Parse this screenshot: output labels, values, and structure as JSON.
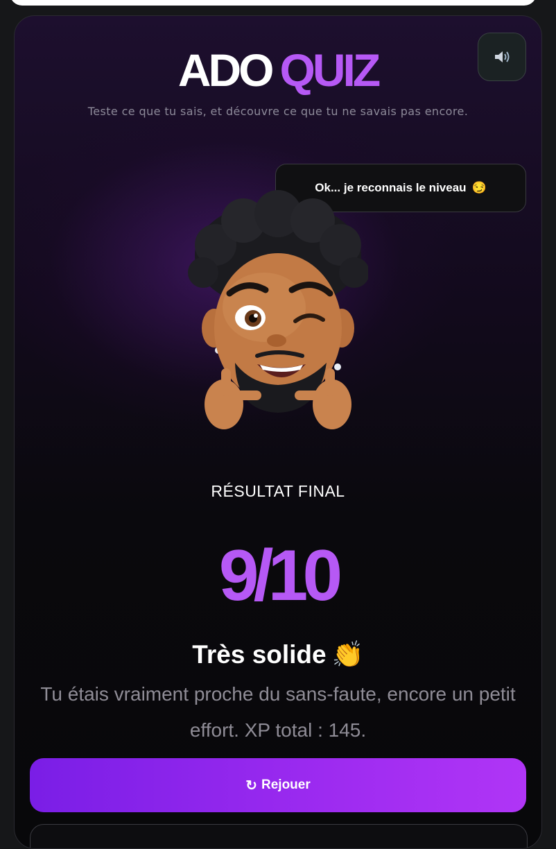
{
  "header": {
    "logo_part1": "ADO",
    "logo_part2": "QUIZ",
    "tagline": "Teste ce que tu sais, et découvre ce que tu ne savais pas encore."
  },
  "sound_button": {
    "icon": "speaker-icon"
  },
  "speech_bubble": {
    "text": "Ok... je reconnais le niveau",
    "emoji": "😏"
  },
  "avatar": {
    "icon": "memoji-avatar-winking"
  },
  "result": {
    "label": "RÉSULTAT FINAL",
    "score": "9/10",
    "verdict": "Très solide",
    "verdict_emoji": "👏",
    "description": "Tu étais vraiment proche du sans-faute, encore un petit effort. XP total : 145."
  },
  "actions": {
    "replay_icon": "↻",
    "replay_label": "Rejouer"
  },
  "colors": {
    "accent": "#b659f5",
    "button_gradient_start": "#7a1ee6",
    "button_gradient_end": "#b035f6"
  }
}
